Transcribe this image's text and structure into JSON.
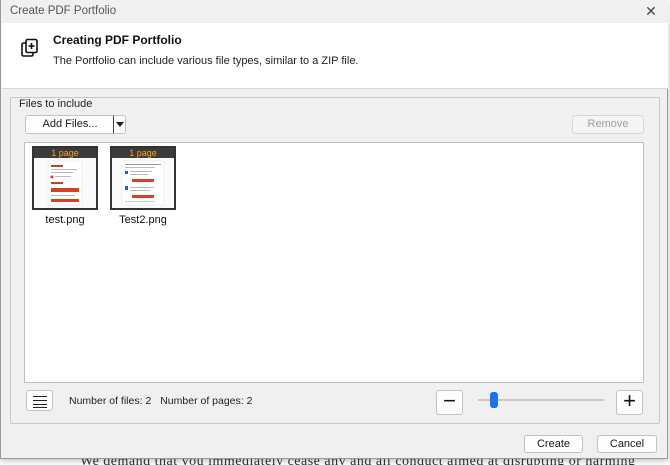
{
  "window": {
    "title": "Create PDF Portfolio",
    "close_glyph": "✕"
  },
  "header": {
    "icon": "portfolio-add-icon",
    "title": "Creating PDF Portfolio",
    "description": "The Portfolio can include various file types, similar to a ZIP file."
  },
  "files_group": {
    "legend": "Files to include",
    "add_files_label": "Add Files...",
    "remove_label": "Remove",
    "files": [
      {
        "name": "test.png",
        "badge": "1 page"
      },
      {
        "name": "Test2.png",
        "badge": "1 page"
      }
    ]
  },
  "footer_bar": {
    "list_view_icon": "list-view-icon",
    "num_files": "Number of files: 2",
    "num_pages": "Number of pages: 2",
    "zoom_out": "−",
    "zoom_in": "+",
    "zoom_level": 0.1
  },
  "buttons": {
    "create": "Create",
    "cancel": "Cancel"
  },
  "background_text": "We demand that you immediately cease any and all conduct aimed at disrupting or harming",
  "colors": {
    "accent": "#1a73e8",
    "badge_text": "#f7a31f",
    "badge_bg": "#3b3b3b"
  }
}
